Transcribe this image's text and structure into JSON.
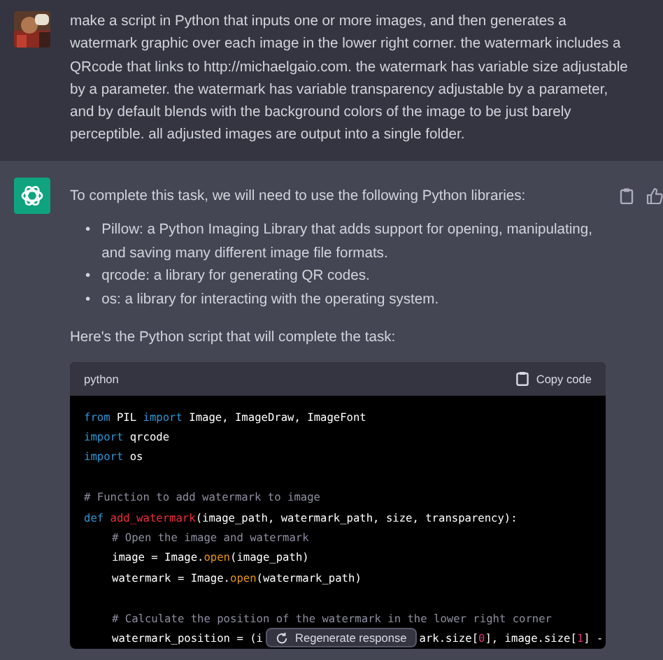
{
  "user_message": {
    "text": "make a script in Python that inputs one or more images, and then generates a watermark graphic over each image in the lower right corner. the watermark includes a QRcode that links to http://michaelgaio.com. the watermark has variable size adjustable by a parameter. the watermark has variable transparency adjustable by a parameter, and by default blends with the background colors of the image to be just barely perceptible. all adjusted images are output into a single folder."
  },
  "assistant_message": {
    "intro": "To complete this task, we will need to use the following Python libraries:",
    "bullets": [
      {
        "marker": "•",
        "text": "Pillow: a Python Imaging Library that adds support for opening, manipulating, and saving many different image file formats."
      },
      {
        "marker": "•",
        "text": "qrcode: a library for generating QR codes."
      },
      {
        "marker": "•",
        "text": "os: a library for interacting with the operating system."
      }
    ],
    "lead": "Here's the Python script that will complete the task:",
    "code_block": {
      "language": "python",
      "copy_label": "Copy code",
      "lines": [
        {
          "kind": "code",
          "tokens": [
            {
              "kind": "keyword",
              "text": "from"
            },
            {
              "kind": "plain",
              "text": " PIL "
            },
            {
              "kind": "keyword",
              "text": "import"
            },
            {
              "kind": "plain",
              "text": " Image, ImageDraw, ImageFont"
            }
          ]
        },
        {
          "kind": "code",
          "tokens": [
            {
              "kind": "keyword",
              "text": "import"
            },
            {
              "kind": "plain",
              "text": " qrcode"
            }
          ]
        },
        {
          "kind": "code",
          "tokens": [
            {
              "kind": "keyword",
              "text": "import"
            },
            {
              "kind": "plain",
              "text": " os"
            }
          ]
        },
        {
          "kind": "blank"
        },
        {
          "kind": "code",
          "tokens": [
            {
              "kind": "comment",
              "text": "# Function to add watermark to image"
            }
          ]
        },
        {
          "kind": "code",
          "tokens": [
            {
              "kind": "keyword",
              "text": "def"
            },
            {
              "kind": "function",
              "text": "add_watermark"
            },
            {
              "kind": "plain",
              "text": "(image_path, watermark_path, size, transparency):"
            }
          ]
        },
        {
          "kind": "nested",
          "tokens": [
            {
              "kind": "comment",
              "text": "# Open the image and watermark"
            }
          ]
        },
        {
          "kind": "nested",
          "tokens": [
            {
              "kind": "plain",
              "text": "image = Image."
            },
            {
              "kind": "builtin",
              "text": "open"
            },
            {
              "kind": "plain",
              "text": "(image_path)"
            }
          ]
        },
        {
          "kind": "nested",
          "tokens": [
            {
              "kind": "plain",
              "text": "watermark = Image."
            },
            {
              "kind": "builtin",
              "text": "open"
            },
            {
              "kind": "plain",
              "text": "(watermark_path)"
            }
          ]
        },
        {
          "kind": "blank"
        },
        {
          "kind": "nested",
          "tokens": [
            {
              "kind": "comment",
              "text": "# Calculate the position of the watermark in the lower right corner"
            }
          ]
        },
        {
          "kind": "split",
          "tokens": [
            {
              "kind": "plain",
              "text": "watermark_position = (i"
            }
          ],
          "after_button": [
            {
              "kind": "plain",
              "text": "ark.size["
            },
            {
              "kind": "number",
              "text": "0"
            },
            {
              "kind": "plain",
              "text": "], image.size["
            },
            {
              "kind": "number",
              "text": "1"
            },
            {
              "kind": "plain",
              "text": "] -"
            }
          ]
        }
      ]
    }
  },
  "regenerate_button": {
    "label": "Regenerate response"
  }
}
